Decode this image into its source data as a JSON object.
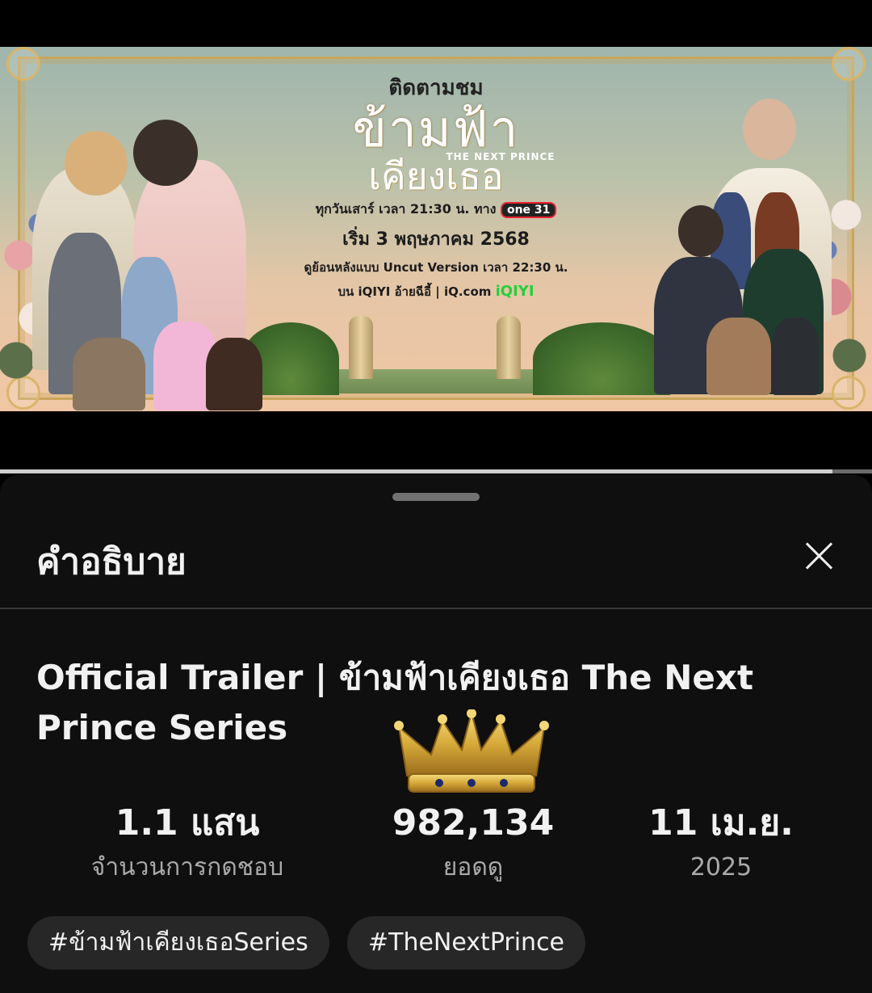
{
  "banner": {
    "follow": "ติดตามชม",
    "title_line1": "ข้ามฟ้า",
    "next_prince": "THE NEXT PRINCE",
    "title_line2": "เคียงเธอ",
    "schedule": "ทุกวันเสาร์ เวลา 21:30 น. ทาง",
    "channel": "one 31",
    "start_date": "เริ่ม 3 พฤษภาคม 2568",
    "uncut": "ดูย้อนหลังแบบ Uncut Version เวลา 22:30 น.",
    "platform": "บน iQIYI อ้ายฉีอี้ | iQ.com",
    "iq_logo": "iQIYI"
  },
  "player": {
    "progress": 0.955
  },
  "sheet": {
    "title": "คำอธิบาย",
    "close_icon": "close-icon",
    "video_title": "Official Trailer | ข้ามฟ้าเคียงเธอ The Next Prince Series",
    "stats": [
      {
        "value": "1.1 แสน",
        "label": "จำนวนการกดชอบ"
      },
      {
        "value": "982,134",
        "label": "ยอดดู"
      },
      {
        "value": "11 เม.ย.",
        "label": "2025"
      }
    ],
    "hashtags": [
      "#ข้ามฟ้าเคียงเธอSeries",
      "#TheNextPrince"
    ]
  },
  "colors": {
    "sheet_bg": "#0f0f0f",
    "chip_bg": "#272727",
    "accent_gold": "#d6a93a"
  }
}
